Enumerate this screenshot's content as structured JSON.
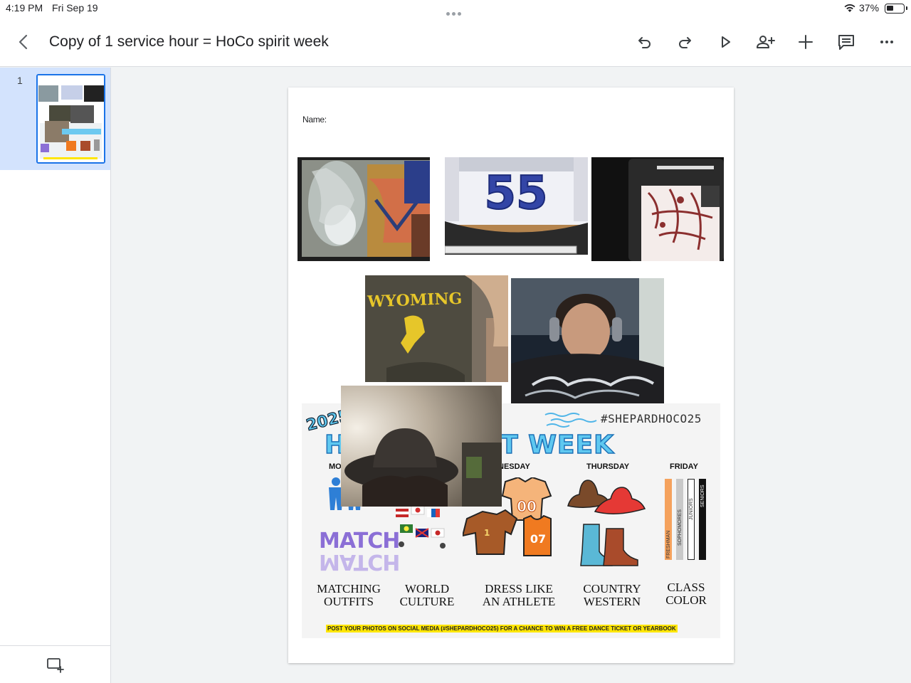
{
  "status": {
    "time": "4:19 PM",
    "date": "Fri Sep 19",
    "battery": "37%"
  },
  "toolbar": {
    "title": "Copy of 1 service hour = HoCo spirit week",
    "icons": [
      "back-icon",
      "undo-icon",
      "redo-icon",
      "play-icon",
      "add-person-icon",
      "insert-plus-icon",
      "comment-icon",
      "more-icon"
    ]
  },
  "sidebar": {
    "slide_number": "1",
    "add_slide_icon": "add-slide-icon"
  },
  "page": {
    "name_label": "Name:"
  },
  "flyer": {
    "hashtag": "#SHEPARDHOCO25",
    "year": "2025",
    "title": "HOCO SPIRIT WEEK",
    "days": [
      "MO",
      "NESDAY",
      "THURSDAY",
      "FRIDAY"
    ],
    "themes": [
      {
        "line1": "MATCHING",
        "line2": "OUTFITS"
      },
      {
        "line1": "WORLD",
        "line2": "CULTURE"
      },
      {
        "line1": "DRESS LIKE",
        "line2": "AN ATHLETE"
      },
      {
        "line1": "COUNTRY",
        "line2": "WESTERN"
      },
      {
        "line1": "CLASS",
        "line2": "COLOR"
      }
    ],
    "match_word": "MATCH",
    "class_bars": [
      "FRESHMAN",
      "SOPHOMORES",
      "JUNIORS",
      "SENIORS"
    ],
    "jersey_numbers": [
      "00",
      "1",
      "07"
    ],
    "footer": "POST YOUR PHOTOS ON SOCIAL MEDIA (#SHEPARDHOCO25) FOR A CHANCE TO WIN A FREE DANCE TICKET OR YEARBOOK"
  },
  "photos": {
    "wyoming_text": "WYOMING",
    "jersey_number": "55"
  }
}
